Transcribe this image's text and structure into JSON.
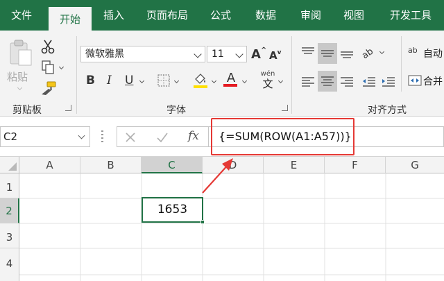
{
  "tabs": [
    "文件",
    "开始",
    "插入",
    "页面布局",
    "公式",
    "数据",
    "审阅",
    "视图",
    "开发工具"
  ],
  "active_tab": "开始",
  "clipboard": {
    "paste_label": "粘贴",
    "group_label": "剪贴板"
  },
  "font": {
    "name": "微软雅黑",
    "size": "11",
    "group_label": "字体",
    "bold": "B",
    "italic": "I",
    "underline": "U",
    "grow": "A",
    "shrink": "A",
    "font_color_glyph": "A",
    "phonetic_top": "wén",
    "phonetic_bottom": "文"
  },
  "alignment": {
    "group_label": "对齐方式",
    "wrap_label": "自动",
    "merge_label": "合并",
    "orientation_glyph": "ab"
  },
  "name_box": "C2",
  "fx_label": "fx",
  "formula": "{=SUM(ROW(A1:A57))}",
  "columns": [
    "A",
    "B",
    "C",
    "D",
    "E",
    "F",
    "G"
  ],
  "rows": [
    "1",
    "2",
    "3",
    "4"
  ],
  "selected_column": "C",
  "selected_row": "2",
  "active_cell_value": "1653",
  "colors": {
    "excel_green": "#217346",
    "highlight_red": "#e53935",
    "font_red": "#e51c23",
    "fill_yellow": "#ffe000"
  }
}
